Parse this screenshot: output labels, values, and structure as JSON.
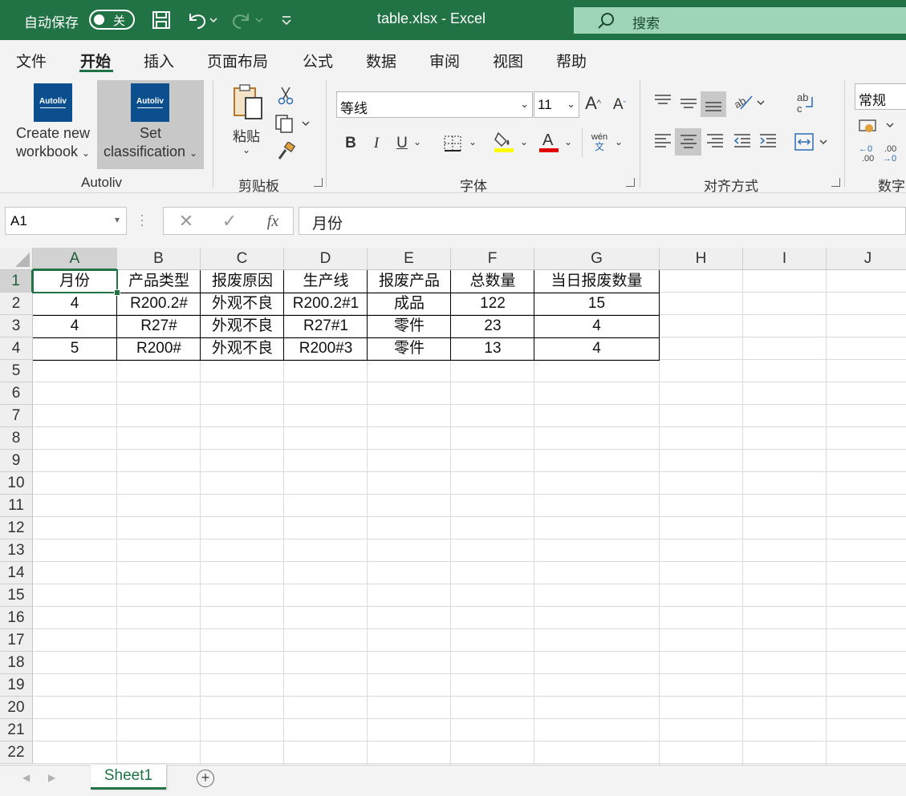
{
  "titlebar": {
    "autosave_label": "自动保存",
    "autosave_state": "关",
    "doc_title": "table.xlsx  -  Excel",
    "search_label": "搜索"
  },
  "tabs": [
    "文件",
    "开始",
    "插入",
    "页面布局",
    "公式",
    "数据",
    "审阅",
    "视图",
    "帮助"
  ],
  "active_tab": "开始",
  "ribbon": {
    "autoliv": {
      "logo_text": "Autoliv",
      "create_line1": "Create new",
      "create_line2": "workbook",
      "set_line1": "Set",
      "set_line2": "classification",
      "group_label": "Autoliv"
    },
    "clipboard": {
      "paste_label": "粘贴",
      "group_label": "剪贴板"
    },
    "font": {
      "font_name": "等线",
      "font_size": "11",
      "group_label": "字体",
      "phonetic_top": "wén",
      "phonetic_bottom": "文"
    },
    "alignment": {
      "group_label": "对齐方式"
    },
    "number": {
      "format": "常规",
      "group_label": "数字"
    }
  },
  "formula_bar": {
    "name_box": "A1",
    "content": "月份"
  },
  "grid": {
    "columns": [
      "A",
      "B",
      "C",
      "D",
      "E",
      "F",
      "G",
      "H",
      "I",
      "J"
    ],
    "rows": [
      "1",
      "2",
      "3",
      "4",
      "5",
      "6",
      "7",
      "8",
      "9",
      "10",
      "11",
      "12",
      "13",
      "14",
      "15",
      "16",
      "17",
      "18",
      "19",
      "20",
      "21",
      "22"
    ],
    "table": [
      [
        "月份",
        "产品类型",
        "报废原因",
        "生产线",
        "报废产品",
        "总数量",
        "当日报废数量"
      ],
      [
        "4",
        "R200.2#",
        "外观不良",
        "R200.2#1",
        "成品",
        "122",
        "15"
      ],
      [
        "4",
        "R27#",
        "外观不良",
        "R27#1",
        "零件",
        "23",
        "4"
      ],
      [
        "5",
        "R200#",
        "外观不良",
        "R200#3",
        "零件",
        "13",
        "4"
      ]
    ]
  },
  "sheets": [
    "Sheet1"
  ],
  "colors": {
    "accent": "#217346",
    "search_bg": "#9fd5b7",
    "logo": "#0b4f8f"
  }
}
